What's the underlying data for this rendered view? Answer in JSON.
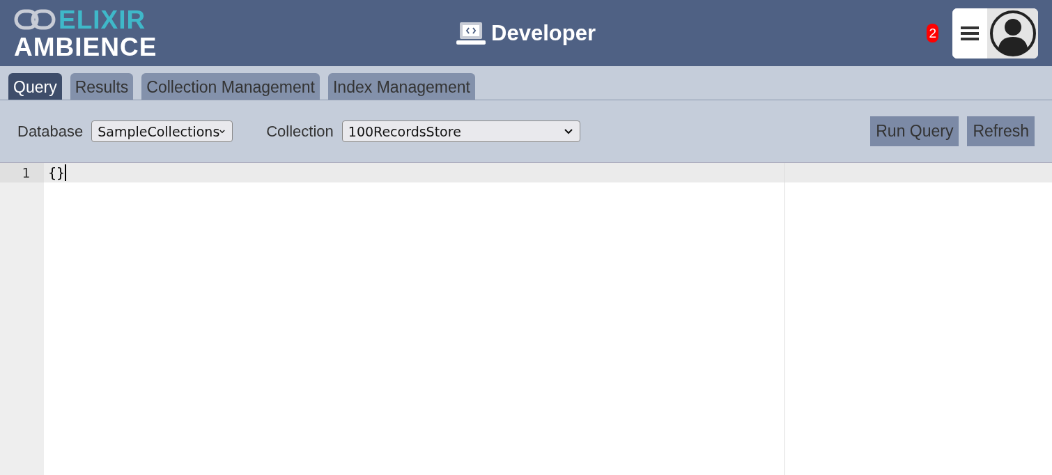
{
  "header": {
    "logo": {
      "top": "ELIXIR",
      "bottom": "AMBIENCE"
    },
    "title": "Developer",
    "notification_count": "2"
  },
  "tabs": [
    {
      "label": "Query",
      "selected": true
    },
    {
      "label": "Results",
      "selected": false
    },
    {
      "label": "Collection Management",
      "selected": false
    },
    {
      "label": "Index Management",
      "selected": false
    }
  ],
  "toolbar": {
    "database": {
      "label": "Database",
      "value": "SampleCollections"
    },
    "collection": {
      "label": "Collection",
      "value": "100RecordsStore"
    },
    "buttons": [
      "Run Query",
      "Refresh"
    ]
  },
  "editor": {
    "lines": [
      {
        "number": "1",
        "text": "{}",
        "active": true
      }
    ]
  }
}
